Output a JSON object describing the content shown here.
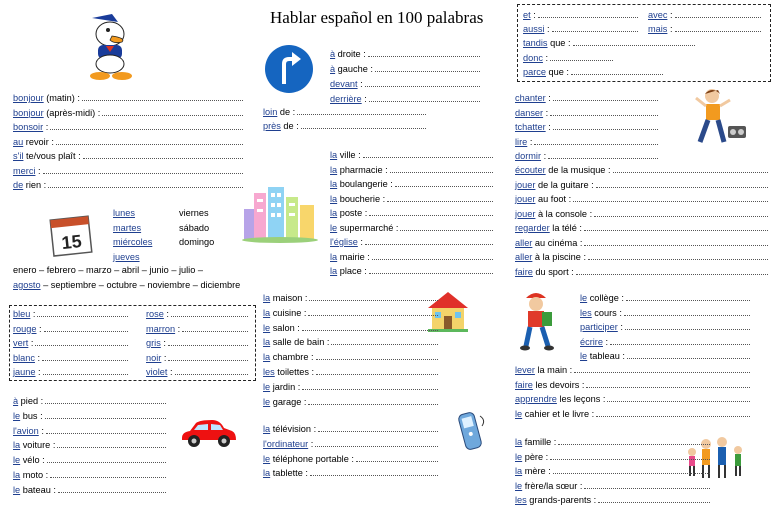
{
  "title": "Hablar español en 100 palabras",
  "connectors": [
    {
      "w": "et",
      "r": " :"
    },
    {
      "w": "avec",
      "r": " :"
    },
    {
      "w": "aussi",
      "r": " :"
    },
    {
      "w": "mais",
      "r": " :"
    },
    {
      "w": "tandis",
      "r": " que :"
    },
    {
      "w": "donc",
      "r": " :"
    },
    {
      "w": "parce",
      "r": " que :"
    }
  ],
  "directions": [
    {
      "w": "à",
      "r": " droite :"
    },
    {
      "w": "à",
      "r": " gauche :"
    },
    {
      "w": "devant",
      "r": " :"
    },
    {
      "w": "derrière",
      "r": " :"
    },
    {
      "w": "loin",
      "r": " de :"
    },
    {
      "w": "près",
      "r": " de :"
    }
  ],
  "greetings": [
    {
      "w": "bonjour",
      "r": " (matin) :"
    },
    {
      "w": "bonjour",
      "r": " (après-midi) :"
    },
    {
      "w": "bonsoir",
      "r": " :"
    },
    {
      "w": "au",
      "r": " revoir :"
    },
    {
      "w": "s'il",
      "r": " te/vous plaît :"
    },
    {
      "w": "merci",
      "r": " :"
    },
    {
      "w": "de",
      "r": " rien :"
    }
  ],
  "days": {
    "col1": [
      "lunes",
      "martes",
      "miércoles",
      "jueves"
    ],
    "col2": [
      "viernes",
      "sábado",
      "domingo"
    ]
  },
  "months": {
    "line1": "enero – febrero – marzo – abril – junio – julio –",
    "line2_u": "agosto",
    "line2_r": " – septiembre – octubre – noviembre – diciembre"
  },
  "calendar_number": "15",
  "colors": [
    {
      "w": "bleu",
      "r": " :"
    },
    {
      "w": "rose",
      "r": " :"
    },
    {
      "w": "rouge",
      "r": " :"
    },
    {
      "w": "marron",
      "r": " :"
    },
    {
      "w": "vert",
      "r": " :"
    },
    {
      "w": "gris",
      "r": " :"
    },
    {
      "w": "blanc",
      "r": " :"
    },
    {
      "w": "noir",
      "r": " :"
    },
    {
      "w": "jaune",
      "r": " :"
    },
    {
      "w": "violet",
      "r": " :"
    }
  ],
  "transport": [
    {
      "w": "à",
      "r": " pied :"
    },
    {
      "w": "le",
      "r": " bus :"
    },
    {
      "w": "l'avion",
      "r": " :"
    },
    {
      "w": "la",
      "r": " voiture :"
    },
    {
      "w": "le",
      "r": " vélo :"
    },
    {
      "w": "la",
      "r": " moto :"
    },
    {
      "w": "le",
      "r": " bateau :"
    }
  ],
  "town": [
    {
      "w": "la",
      "r": " ville :"
    },
    {
      "w": "la",
      "r": " pharmacie :"
    },
    {
      "w": "la",
      "r": " boulangerie :"
    },
    {
      "w": "la",
      "r": " boucherie :"
    },
    {
      "w": "la",
      "r": " poste :"
    },
    {
      "w": "le",
      "r": " supermarché :"
    },
    {
      "w": "l'église",
      "r": " :"
    },
    {
      "w": "la",
      "r": " mairie :"
    },
    {
      "w": "la",
      "r": " place :"
    }
  ],
  "house": [
    {
      "w": "la",
      "r": " maison :"
    },
    {
      "w": "la",
      "r": " cuisine :"
    },
    {
      "w": "le",
      "r": " salon :"
    },
    {
      "w": "la",
      "r": " salle de bain :"
    },
    {
      "w": "la",
      "r": " chambre :"
    },
    {
      "w": "les",
      "r": " toilettes :"
    },
    {
      "w": "le",
      "r": " jardin :"
    },
    {
      "w": "le",
      "r": " garage :"
    }
  ],
  "tech": [
    {
      "w": "la",
      "r": " télévision :"
    },
    {
      "w": "l'ordinateur",
      "r": " :"
    },
    {
      "w": "le",
      "r": " téléphone portable :"
    },
    {
      "w": "la",
      "r": " tablette :"
    }
  ],
  "activities": [
    {
      "w": "chanter",
      "r": " :"
    },
    {
      "w": "danser",
      "r": " :"
    },
    {
      "w": "tchatter",
      "r": " :"
    },
    {
      "w": "lire",
      "r": " :"
    },
    {
      "w": "dormir",
      "r": " :"
    },
    {
      "w": "écouter",
      "r": " de la musique :"
    },
    {
      "w": "jouer",
      "r": " de la guitare :"
    },
    {
      "w": "jouer",
      "r": " au foot :"
    },
    {
      "w": "jouer",
      "r": " à la console :"
    },
    {
      "w": "regarder",
      "r": " la télé :"
    },
    {
      "w": "aller",
      "r": " au cinéma :"
    },
    {
      "w": "aller",
      "r": " à la piscine :"
    },
    {
      "w": "faire",
      "r": " du sport :"
    }
  ],
  "school": [
    {
      "w": "le",
      "r": " collège :"
    },
    {
      "w": "les",
      "r": " cours :"
    },
    {
      "w": "participer",
      "r": " :"
    },
    {
      "w": "écrire",
      "r": " :"
    },
    {
      "w": "le",
      "r": " tableau :"
    },
    {
      "w": "lever",
      "r": " la main :"
    },
    {
      "w": "faire",
      "r": " les devoirs :"
    },
    {
      "w": "apprendre",
      "r": " les leçons :"
    },
    {
      "w": "le",
      "r": " cahier et le livre :"
    }
  ],
  "family": [
    {
      "w": "la",
      "r": " famille :"
    },
    {
      "w": "le",
      "r": " père :"
    },
    {
      "w": "la",
      "r": " mère :"
    },
    {
      "w": "le",
      "r": " frère/la sœur :"
    },
    {
      "w": "les",
      "r": " grands-parents :"
    }
  ]
}
